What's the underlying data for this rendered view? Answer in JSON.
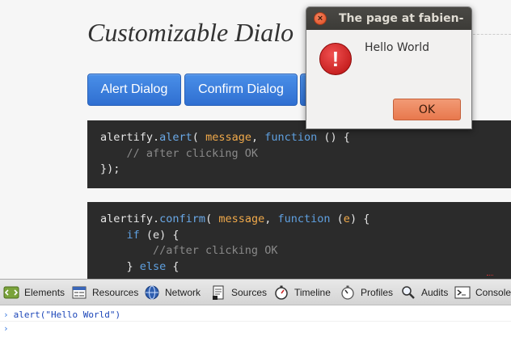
{
  "page": {
    "title": "Customizable Dialo",
    "buttons": {
      "alert_label": "Alert Dialog",
      "confirm_label": "Confirm Dialog"
    },
    "code_block_1": {
      "line1": {
        "obj": "alertify.",
        "fn": "alert",
        "open": "( ",
        "arg": "message",
        "sep": ", ",
        "kw": "function",
        "rest": " () {"
      },
      "line2": "    // after clicking OK",
      "line3": "});"
    },
    "code_block_2": {
      "line1": {
        "obj": "alertify.",
        "fn": "confirm",
        "open": "( ",
        "arg": "message",
        "sep": ", ",
        "kw": "function",
        "paren_open": " (",
        "param": "e",
        "rest": ") {"
      },
      "line2": {
        "indent": "    ",
        "kw": "if",
        "rest": " (e) {"
      },
      "line3": "        //after clicking OK",
      "line4": {
        "indent": "    ",
        "brace": "} ",
        "kw": "else",
        "rest": " {"
      }
    }
  },
  "dialog": {
    "title": "The page at fabien-",
    "close_glyph": "×",
    "error_glyph": "!",
    "message": "Hello World",
    "ok_label": "OK"
  },
  "devtools": {
    "tools": [
      {
        "label": "Elements"
      },
      {
        "label": "Resources"
      },
      {
        "label": "Network"
      },
      {
        "label": "Sources"
      },
      {
        "label": "Timeline"
      },
      {
        "label": "Profiles"
      },
      {
        "label": "Audits"
      },
      {
        "label": "Console"
      }
    ]
  },
  "console": {
    "prompt": "›",
    "entry": "alert(\"Hello World\")"
  }
}
